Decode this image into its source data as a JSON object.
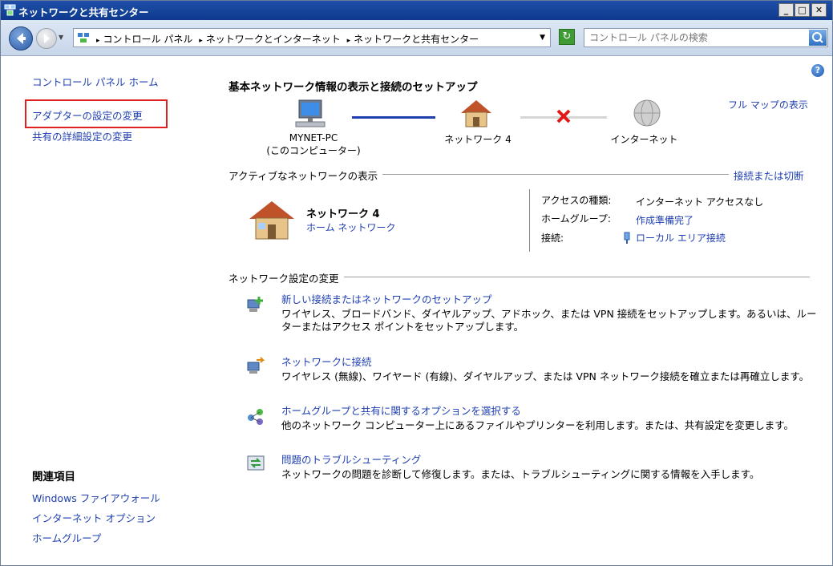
{
  "window": {
    "title": "ネットワークと共有センター"
  },
  "address_bar": {
    "crumbs": [
      "コントロール パネル",
      "ネットワークとインターネット",
      "ネットワークと共有センター"
    ],
    "search_placeholder": "コントロール パネルの検索"
  },
  "left_nav": {
    "home": "コントロール パネル ホーム",
    "adapter": "アダプターの設定の変更",
    "advanced_sharing": "共有の詳細設定の変更",
    "related_heading": "関連項目",
    "related": [
      "Windows ファイアウォール",
      "インターネット オプション",
      "ホームグループ"
    ]
  },
  "main": {
    "heading": "基本ネットワーク情報の表示と接続のセットアップ",
    "full_map": "フル マップの表示",
    "map": {
      "computer": "MYNET-PC",
      "computer_sub": "(このコンピューター)",
      "network": "ネットワーク 4",
      "internet": "インターネット"
    },
    "active_section": "アクティブなネットワークの表示",
    "connect_disconnect": "接続または切断",
    "network_name": "ネットワーク 4",
    "network_type": "ホーム ネットワーク",
    "info": {
      "access_type_label": "アクセスの種類:",
      "access_type_value": "インターネット アクセスなし",
      "homegroup_label": "ホームグループ:",
      "homegroup_value": "作成準備完了",
      "connections_label": "接続:",
      "connections_value": "ローカル エリア接続"
    },
    "change_section": "ネットワーク設定の変更",
    "tasks": [
      {
        "title": "新しい接続またはネットワークのセットアップ",
        "desc": "ワイヤレス、ブロードバンド、ダイヤルアップ、アドホック、または VPN 接続をセットアップします。あるいは、ルーターまたはアクセス ポイントをセットアップします。"
      },
      {
        "title": "ネットワークに接続",
        "desc": "ワイヤレス (無線)、ワイヤード (有線)、ダイヤルアップ、または VPN ネットワーク接続を確立または再確立します。"
      },
      {
        "title": "ホームグループと共有に関するオプションを選択する",
        "desc": "他のネットワーク コンピューター上にあるファイルやプリンターを利用します。または、共有設定を変更します。"
      },
      {
        "title": "問題のトラブルシューティング",
        "desc": "ネットワークの問題を診断して修復します。または、トラブルシューティングに関する情報を入手します。"
      }
    ]
  }
}
